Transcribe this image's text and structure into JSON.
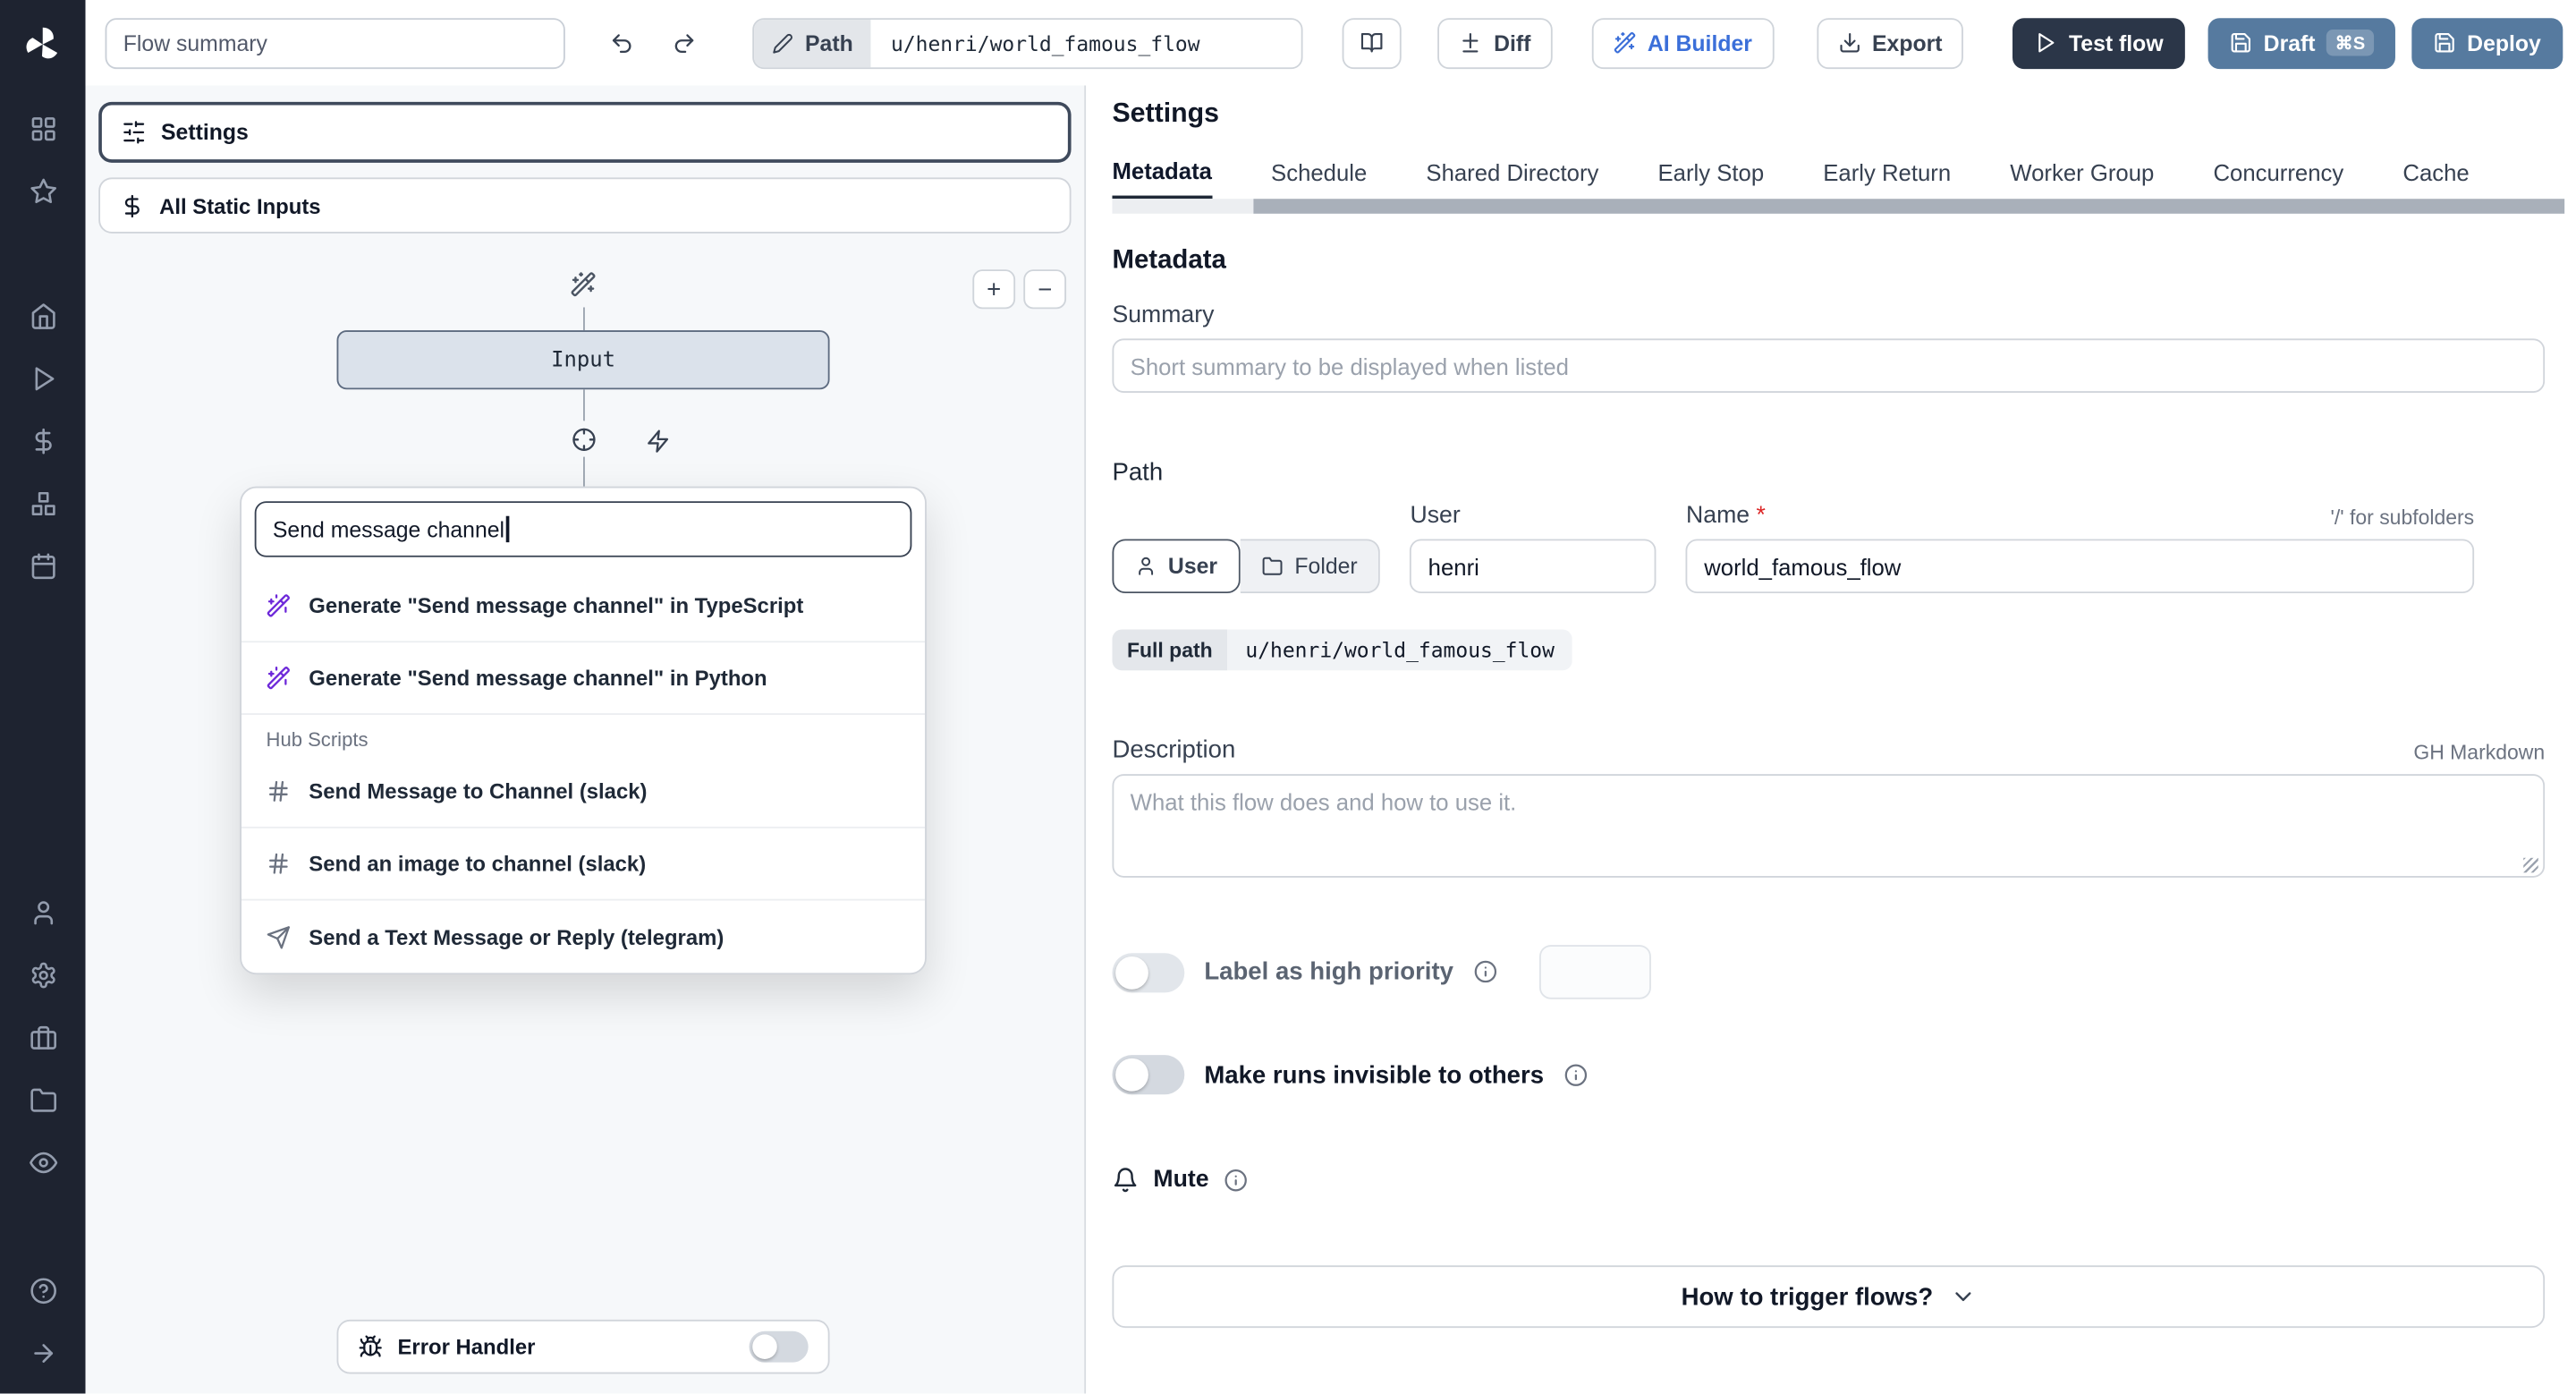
{
  "topbar": {
    "flow_summary_placeholder": "Flow summary",
    "path_button_label": "Path",
    "path_value": "u/henri/world_famous_flow",
    "diff_label": "Diff",
    "ai_builder_label": "AI Builder",
    "export_label": "Export",
    "test_flow_label": "Test flow",
    "draft_label": "Draft",
    "draft_shortcut": "⌘S",
    "deploy_label": "Deploy"
  },
  "canvas": {
    "settings_node_label": "Settings",
    "static_inputs_label": "All Static Inputs",
    "input_node_label": "Input",
    "zoom_in_label": "+",
    "zoom_out_label": "−",
    "error_handler_label": "Error Handler",
    "step_search": {
      "value": "Send message channel",
      "generate_results": [
        "Generate \"Send message channel\" in TypeScript",
        "Generate \"Send message channel\" in Python"
      ],
      "hub_section_label": "Hub Scripts",
      "hub_results": [
        "Send Message to Channel (slack)",
        "Send an image to channel (slack)",
        "Send a Text Message or Reply (telegram)"
      ]
    }
  },
  "settings_panel": {
    "title": "Settings",
    "tabs": [
      {
        "label": "Metadata",
        "active": true
      },
      {
        "label": "Schedule",
        "active": false
      },
      {
        "label": "Shared Directory",
        "active": false
      },
      {
        "label": "Early Stop",
        "active": false
      },
      {
        "label": "Early Return",
        "active": false
      },
      {
        "label": "Worker Group",
        "active": false
      },
      {
        "label": "Concurrency",
        "active": false
      },
      {
        "label": "Cache",
        "active": false
      }
    ],
    "metadata": {
      "heading": "Metadata",
      "summary_label": "Summary",
      "summary_placeholder": "Short summary to be displayed when listed",
      "path_label": "Path",
      "owner_kind_user": "User",
      "owner_kind_folder": "Folder",
      "user_label": "User",
      "user_value": "henri",
      "name_label": "Name",
      "required_mark": "*",
      "name_value": "world_famous_flow",
      "subfolder_hint": "'/' for subfolders",
      "full_path_label": "Full path",
      "full_path_value": "u/henri/world_famous_flow",
      "description_label": "Description",
      "markdown_hint": "GH Markdown",
      "description_placeholder": "What this flow does and how to use it.",
      "high_priority_label": "Label as high priority",
      "invisible_runs_label": "Make runs invisible to others",
      "mute_label": "Mute",
      "trigger_help_label": "How to trigger flows?"
    }
  },
  "colors": {
    "accent_blue": "#3b6fd9",
    "deploy_blue": "#567a9f",
    "dark_navy": "#2b3648",
    "required_red": "#dc2626",
    "sidebar_bg": "#1e2330",
    "canvas_bg": "#f6f8fa",
    "ai_violet": "#6d28d9"
  },
  "sidebar_icons": [
    "windmill-logo",
    "apps",
    "star",
    "home",
    "play",
    "dollar",
    "resources",
    "calendar",
    "user",
    "gear",
    "briefcase",
    "folder",
    "eye",
    "help",
    "arrow-right"
  ]
}
